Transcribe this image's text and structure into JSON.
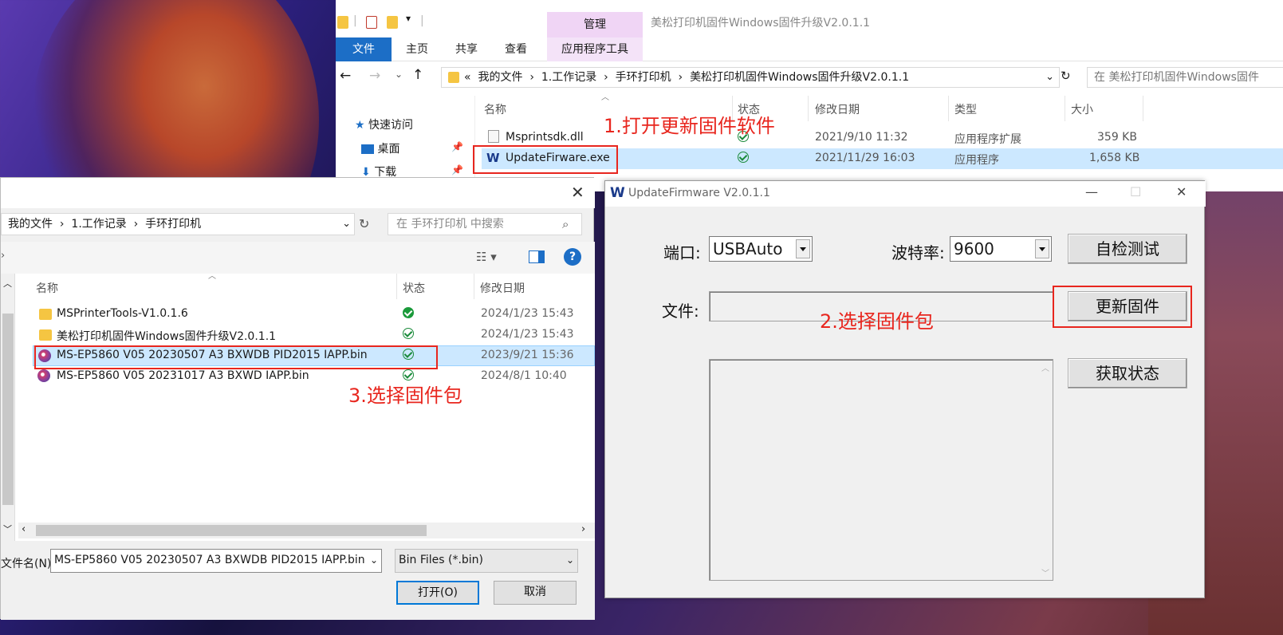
{
  "explorer": {
    "title": "美松打印机固件Windows固件升级V2.0.1.1",
    "manage_tab": "管理",
    "tabs": [
      "文件",
      "主页",
      "共享",
      "查看"
    ],
    "app_tools_tab": "应用程序工具",
    "address": [
      "«",
      "我的文件",
      "1.工作记录",
      "手环打印机",
      "美松打印机固件Windows固件升级V2.0.1.1"
    ],
    "search_placeholder": "在 美松打印机固件Windows固件",
    "nav": [
      "快速访问",
      "桌面",
      "下载"
    ],
    "columns": [
      "名称",
      "状态",
      "修改日期",
      "类型",
      "大小"
    ],
    "files": [
      {
        "name": "Msprintsdk.dll",
        "date": "2021/9/10 11:32",
        "type": "应用程序扩展",
        "size": "359 KB"
      },
      {
        "name": "UpdateFirware.exe",
        "date": "2021/11/29 16:03",
        "type": "应用程序",
        "size": "1,658 KB"
      }
    ]
  },
  "dialog": {
    "address": [
      "我的文件",
      "1.工作记录",
      "手环打印机"
    ],
    "search_placeholder": "在 手环打印机 中搜索",
    "columns": [
      "名称",
      "状态",
      "修改日期"
    ],
    "files": [
      {
        "name": "MSPrinterTools-V1.0.1.6",
        "date": "2024/1/23 15:43",
        "kind": "folder"
      },
      {
        "name": "美松打印机固件Windows固件升级V2.0.1.1",
        "date": "2024/1/23 15:43",
        "kind": "folder"
      },
      {
        "name": "MS-EP5860 V05 20230507 A3 BXWDB PID2015 IAPP.bin",
        "date": "2023/9/21 15:36",
        "kind": "bin"
      },
      {
        "name": "MS-EP5860 V05 20231017 A3 BXWD IAPP.bin",
        "date": "2024/8/1 10:40",
        "kind": "bin"
      }
    ],
    "filename_label": "文件名(N):",
    "filename_value": "MS-EP5860 V05 20230507 A3 BXWDB PID2015 IAPP.bin",
    "filter_value": "Bin Files (*.bin)",
    "open_button": "打开(O)",
    "cancel_button": "取消"
  },
  "app": {
    "title": "UpdateFirmware V2.0.1.1",
    "port_label": "端口:",
    "port_value": "USBAuto",
    "baud_label": "波特率:",
    "baud_value": "9600",
    "selftest_button": "自检测试",
    "file_label": "文件:",
    "file_value": "",
    "update_button": "更新固件",
    "status_button": "获取状态"
  },
  "annotations": {
    "step1": "1.打开更新固件软件",
    "step2": "2.选择固件包",
    "step3": "3.选择固件包"
  },
  "colors": {
    "accent": "#1c6ec6",
    "annotation": "#e8261e",
    "selection": "#cce8ff"
  }
}
